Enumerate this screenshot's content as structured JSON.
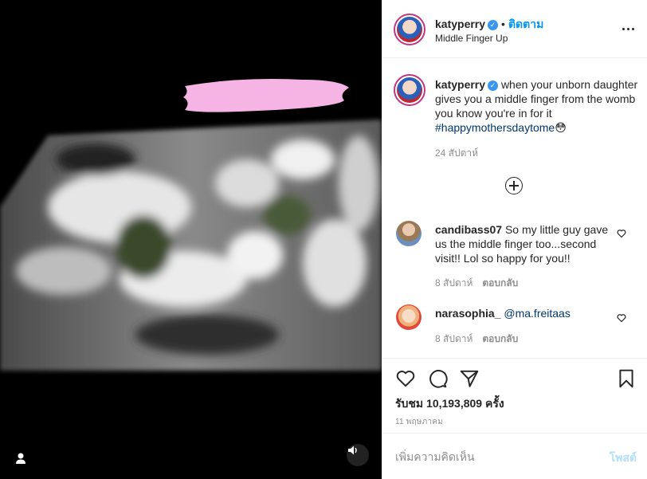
{
  "post": {
    "username": "katyperry",
    "follow_label": "ติดตาม",
    "location": "Middle Finger Up",
    "caption_text": "when your unborn daughter gives you a middle finger from the womb you know you're in for it ",
    "caption_hashtag": "#happymothersdaytome",
    "caption_emoji": "😳",
    "caption_time": "24 สัปดาห์"
  },
  "comments": [
    {
      "username": "candibass07",
      "text": "So my little guy gave us the middle finger too...second visit!! Lol so happy for you!!",
      "time": "8 สัปดาห์",
      "reply_label": "ตอบกลับ"
    },
    {
      "username": "narasophia_",
      "mention": "@ma.freitaas",
      "time": "8 สัปดาห์",
      "reply_label": "ตอบกลับ"
    }
  ],
  "actions": {
    "views": "รับชม 10,193,809 ครั้ง",
    "date": "11 พฤษภาคม"
  },
  "comment_box": {
    "placeholder": "เพิ่มความคิดเห็น",
    "post_label": "โพสต์"
  },
  "icons": [
    "user-tag-icon",
    "volume-icon",
    "verified-badge-icon",
    "more-options-icon",
    "add-comment-icon",
    "heart-icon",
    "comment-icon",
    "share-icon",
    "save-bookmark-icon"
  ],
  "colors": {
    "accent": "#0095f6",
    "hashtag": "#00376b",
    "muted": "#8e8e8e",
    "post_disabled": "#b2dffc",
    "ring": "#c13584"
  }
}
